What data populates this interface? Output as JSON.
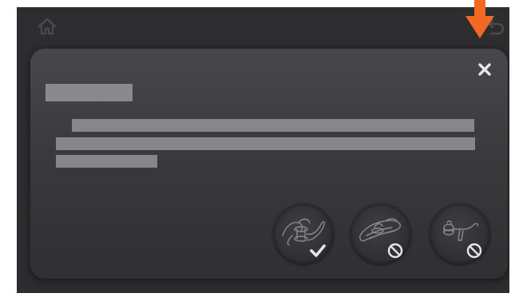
{
  "colors": {
    "screen_bg": "#2d2d2f",
    "modal_bg": "#3e3e41",
    "placeholder_text": "#8a8a8d",
    "icon_light": "#e6e6e6",
    "icon_dim": "#4a4a4d",
    "pointer_accent": "#f26a21"
  },
  "icons": {
    "home": "home-icon",
    "back": "back-icon",
    "close": "close-icon",
    "pointer": "arrow-down-icon",
    "selected": "checkmark-icon",
    "unavailable": "prohibited-icon"
  },
  "tool_options": [
    {
      "id": "option-1",
      "state": "selected"
    },
    {
      "id": "option-2",
      "state": "unavailable"
    },
    {
      "id": "option-3",
      "state": "unavailable"
    }
  ]
}
